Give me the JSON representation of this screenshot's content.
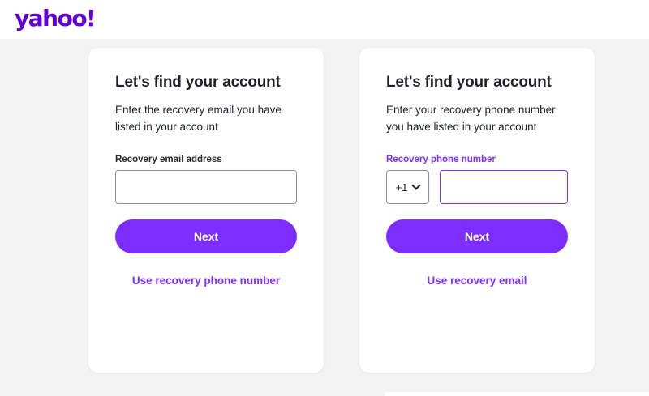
{
  "header": {
    "logo_text": "yahoo!"
  },
  "email_card": {
    "title": "Let's find your account",
    "description": "Enter the recovery email you have listed in your account",
    "field_label": "Recovery email address",
    "input_value": "",
    "next_label": "Next",
    "switch_link": "Use recovery phone number"
  },
  "phone_card": {
    "title": "Let's find your account",
    "description": "Enter your recovery phone number you have listed in your account",
    "field_label": "Recovery phone number",
    "country_code": "+1",
    "input_value": "",
    "next_label": "Next",
    "switch_link": "Use recovery email"
  },
  "colors": {
    "brand": "#6001d2",
    "accent": "#7d2eff",
    "background": "#f3f3f4",
    "text": "#1d2228"
  },
  "icons": {
    "country_dropdown": "chevron-down-icon"
  }
}
